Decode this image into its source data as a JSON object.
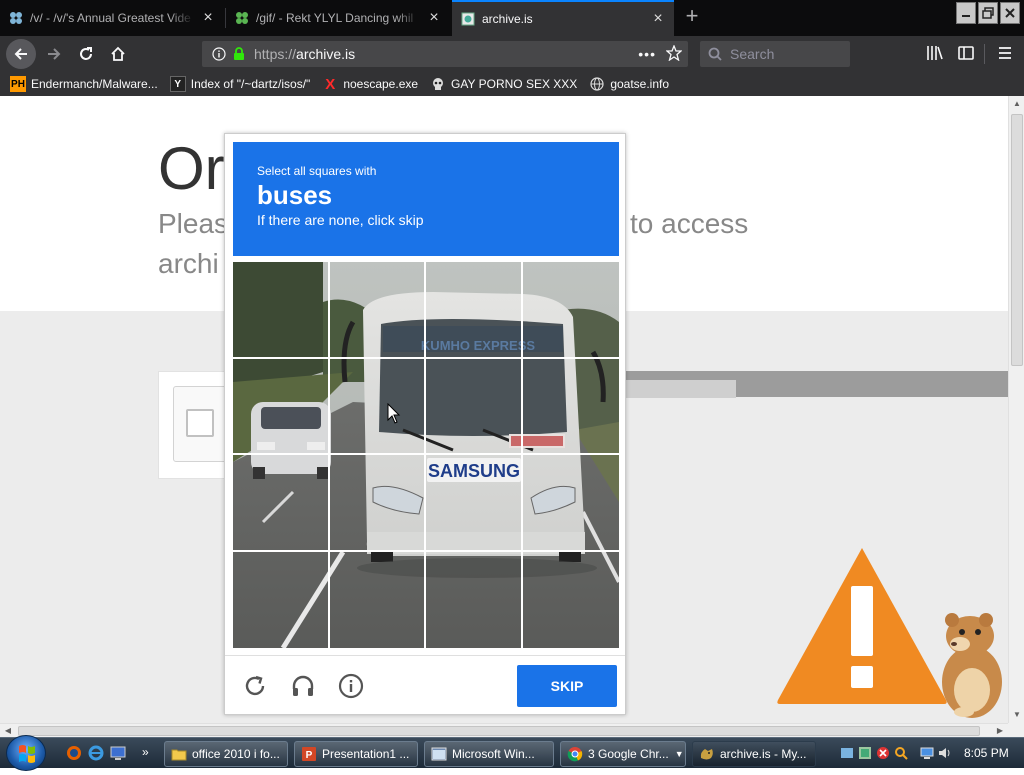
{
  "tabs": [
    {
      "title": "/v/ - /v/'s Annual Greatest Vide",
      "active": false
    },
    {
      "title": "/gif/ - Rekt YLYL Dancing whil",
      "active": false
    },
    {
      "title": "archive.is",
      "active": true
    }
  ],
  "nav": {
    "url_scheme": "https://",
    "url_host": "archive.is",
    "search_placeholder": "Search"
  },
  "bookmarks": [
    {
      "label": "Endermanch/Malware...",
      "icon": "PH"
    },
    {
      "label": "Index of \"/~dartz/isos/\"",
      "icon": "Y"
    },
    {
      "label": "noescape.exe",
      "icon": "X"
    },
    {
      "label": "GAY PORNO SEX XXX",
      "icon": "skull"
    },
    {
      "label": "goatse.info",
      "icon": "globe"
    }
  ],
  "page": {
    "title": "Or",
    "subtitle_left_1": "Pleas",
    "subtitle_right_1": "to access",
    "subtitle_left_2": "archi"
  },
  "captcha": {
    "instruction": "Select all squares with",
    "target": "buses",
    "hint": "If there are none, click skip",
    "skip_label": "SKIP",
    "bus_brand": "SAMSUNG",
    "bus_destination": "KUMHO EXPRESS",
    "colors": {
      "accent": "#1a73e8"
    }
  },
  "taskbar": {
    "items": [
      {
        "label": "office 2010 i fo...",
        "icon": "folder-icon"
      },
      {
        "label": "Presentation1 ...",
        "icon": "powerpoint-icon"
      },
      {
        "label": "Microsoft Win...",
        "icon": "window-icon"
      },
      {
        "label": "3 Google Chr...",
        "icon": "chrome-icon"
      },
      {
        "label": "archive.is - My...",
        "icon": "firefox-icon"
      }
    ],
    "clock": "8:05 PM"
  }
}
